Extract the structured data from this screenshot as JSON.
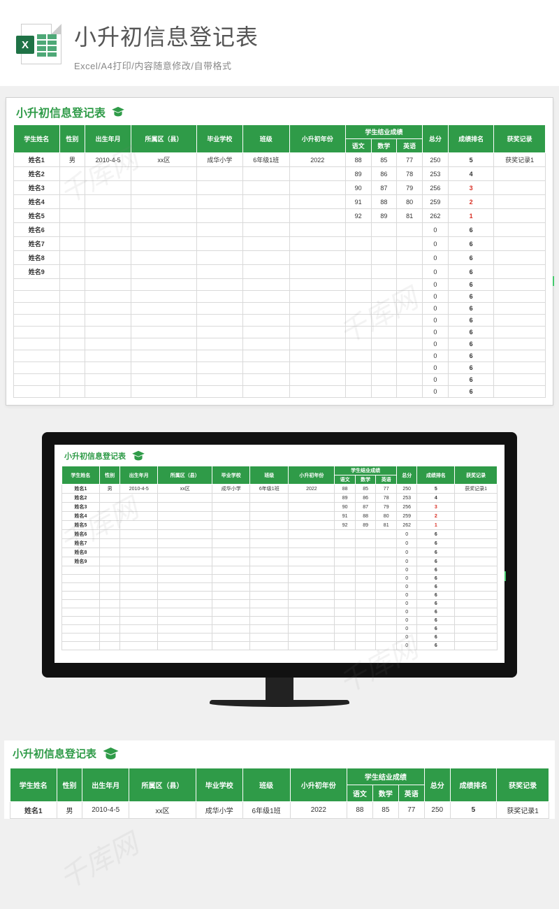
{
  "header": {
    "title": "小升初信息登记表",
    "subtitle": "Excel/A4打印/内容随意修改/自带格式",
    "icon_label": "X"
  },
  "sheet": {
    "title": "小升初信息登记表",
    "columns": {
      "name": "学生姓名",
      "gender": "性别",
      "birth": "出生年月",
      "district": "所属区（县）",
      "school": "毕业学校",
      "class": "班级",
      "year": "小升初年份",
      "scores_group": "学生结业成绩",
      "chinese": "语文",
      "math": "数学",
      "english": "英语",
      "total": "总分",
      "rank": "成绩排名",
      "award": "获奖记录"
    },
    "rows": [
      {
        "name": "姓名1",
        "gender": "男",
        "birth": "2010-4-5",
        "district": "xx区",
        "school": "成华小学",
        "class": "6年级1班",
        "year": "2022",
        "chinese": 88,
        "math": 85,
        "english": 77,
        "total": 250,
        "rank": 5,
        "rank_red": false,
        "award": "获奖记录1"
      },
      {
        "name": "姓名2",
        "gender": "",
        "birth": "",
        "district": "",
        "school": "",
        "class": "",
        "year": "",
        "chinese": 89,
        "math": 86,
        "english": 78,
        "total": 253,
        "rank": 4,
        "rank_red": false,
        "award": ""
      },
      {
        "name": "姓名3",
        "gender": "",
        "birth": "",
        "district": "",
        "school": "",
        "class": "",
        "year": "",
        "chinese": 90,
        "math": 87,
        "english": 79,
        "total": 256,
        "rank": 3,
        "rank_red": true,
        "award": ""
      },
      {
        "name": "姓名4",
        "gender": "",
        "birth": "",
        "district": "",
        "school": "",
        "class": "",
        "year": "",
        "chinese": 91,
        "math": 88,
        "english": 80,
        "total": 259,
        "rank": 2,
        "rank_red": true,
        "award": ""
      },
      {
        "name": "姓名5",
        "gender": "",
        "birth": "",
        "district": "",
        "school": "",
        "class": "",
        "year": "",
        "chinese": 92,
        "math": 89,
        "english": 81,
        "total": 262,
        "rank": 1,
        "rank_red": true,
        "award": ""
      },
      {
        "name": "姓名6",
        "gender": "",
        "birth": "",
        "district": "",
        "school": "",
        "class": "",
        "year": "",
        "chinese": "",
        "math": "",
        "english": "",
        "total": 0,
        "rank": 6,
        "rank_red": false,
        "award": ""
      },
      {
        "name": "姓名7",
        "gender": "",
        "birth": "",
        "district": "",
        "school": "",
        "class": "",
        "year": "",
        "chinese": "",
        "math": "",
        "english": "",
        "total": 0,
        "rank": 6,
        "rank_red": false,
        "award": ""
      },
      {
        "name": "姓名8",
        "gender": "",
        "birth": "",
        "district": "",
        "school": "",
        "class": "",
        "year": "",
        "chinese": "",
        "math": "",
        "english": "",
        "total": 0,
        "rank": 6,
        "rank_red": false,
        "award": ""
      },
      {
        "name": "姓名9",
        "gender": "",
        "birth": "",
        "district": "",
        "school": "",
        "class": "",
        "year": "",
        "chinese": "",
        "math": "",
        "english": "",
        "total": 0,
        "rank": 6,
        "rank_red": false,
        "award": ""
      }
    ],
    "tail_rows": [
      {
        "total": 0,
        "rank": 6
      },
      {
        "total": 0,
        "rank": 6
      },
      {
        "total": 0,
        "rank": 6
      },
      {
        "total": 0,
        "rank": 6
      },
      {
        "total": 0,
        "rank": 6
      },
      {
        "total": 0,
        "rank": 6
      },
      {
        "total": 0,
        "rank": 6
      },
      {
        "total": 0,
        "rank": 6
      },
      {
        "total": 0,
        "rank": 6
      },
      {
        "total": 0,
        "rank": 6
      }
    ]
  },
  "watermark_text": "千库网",
  "bottom_visible_rows": 1
}
